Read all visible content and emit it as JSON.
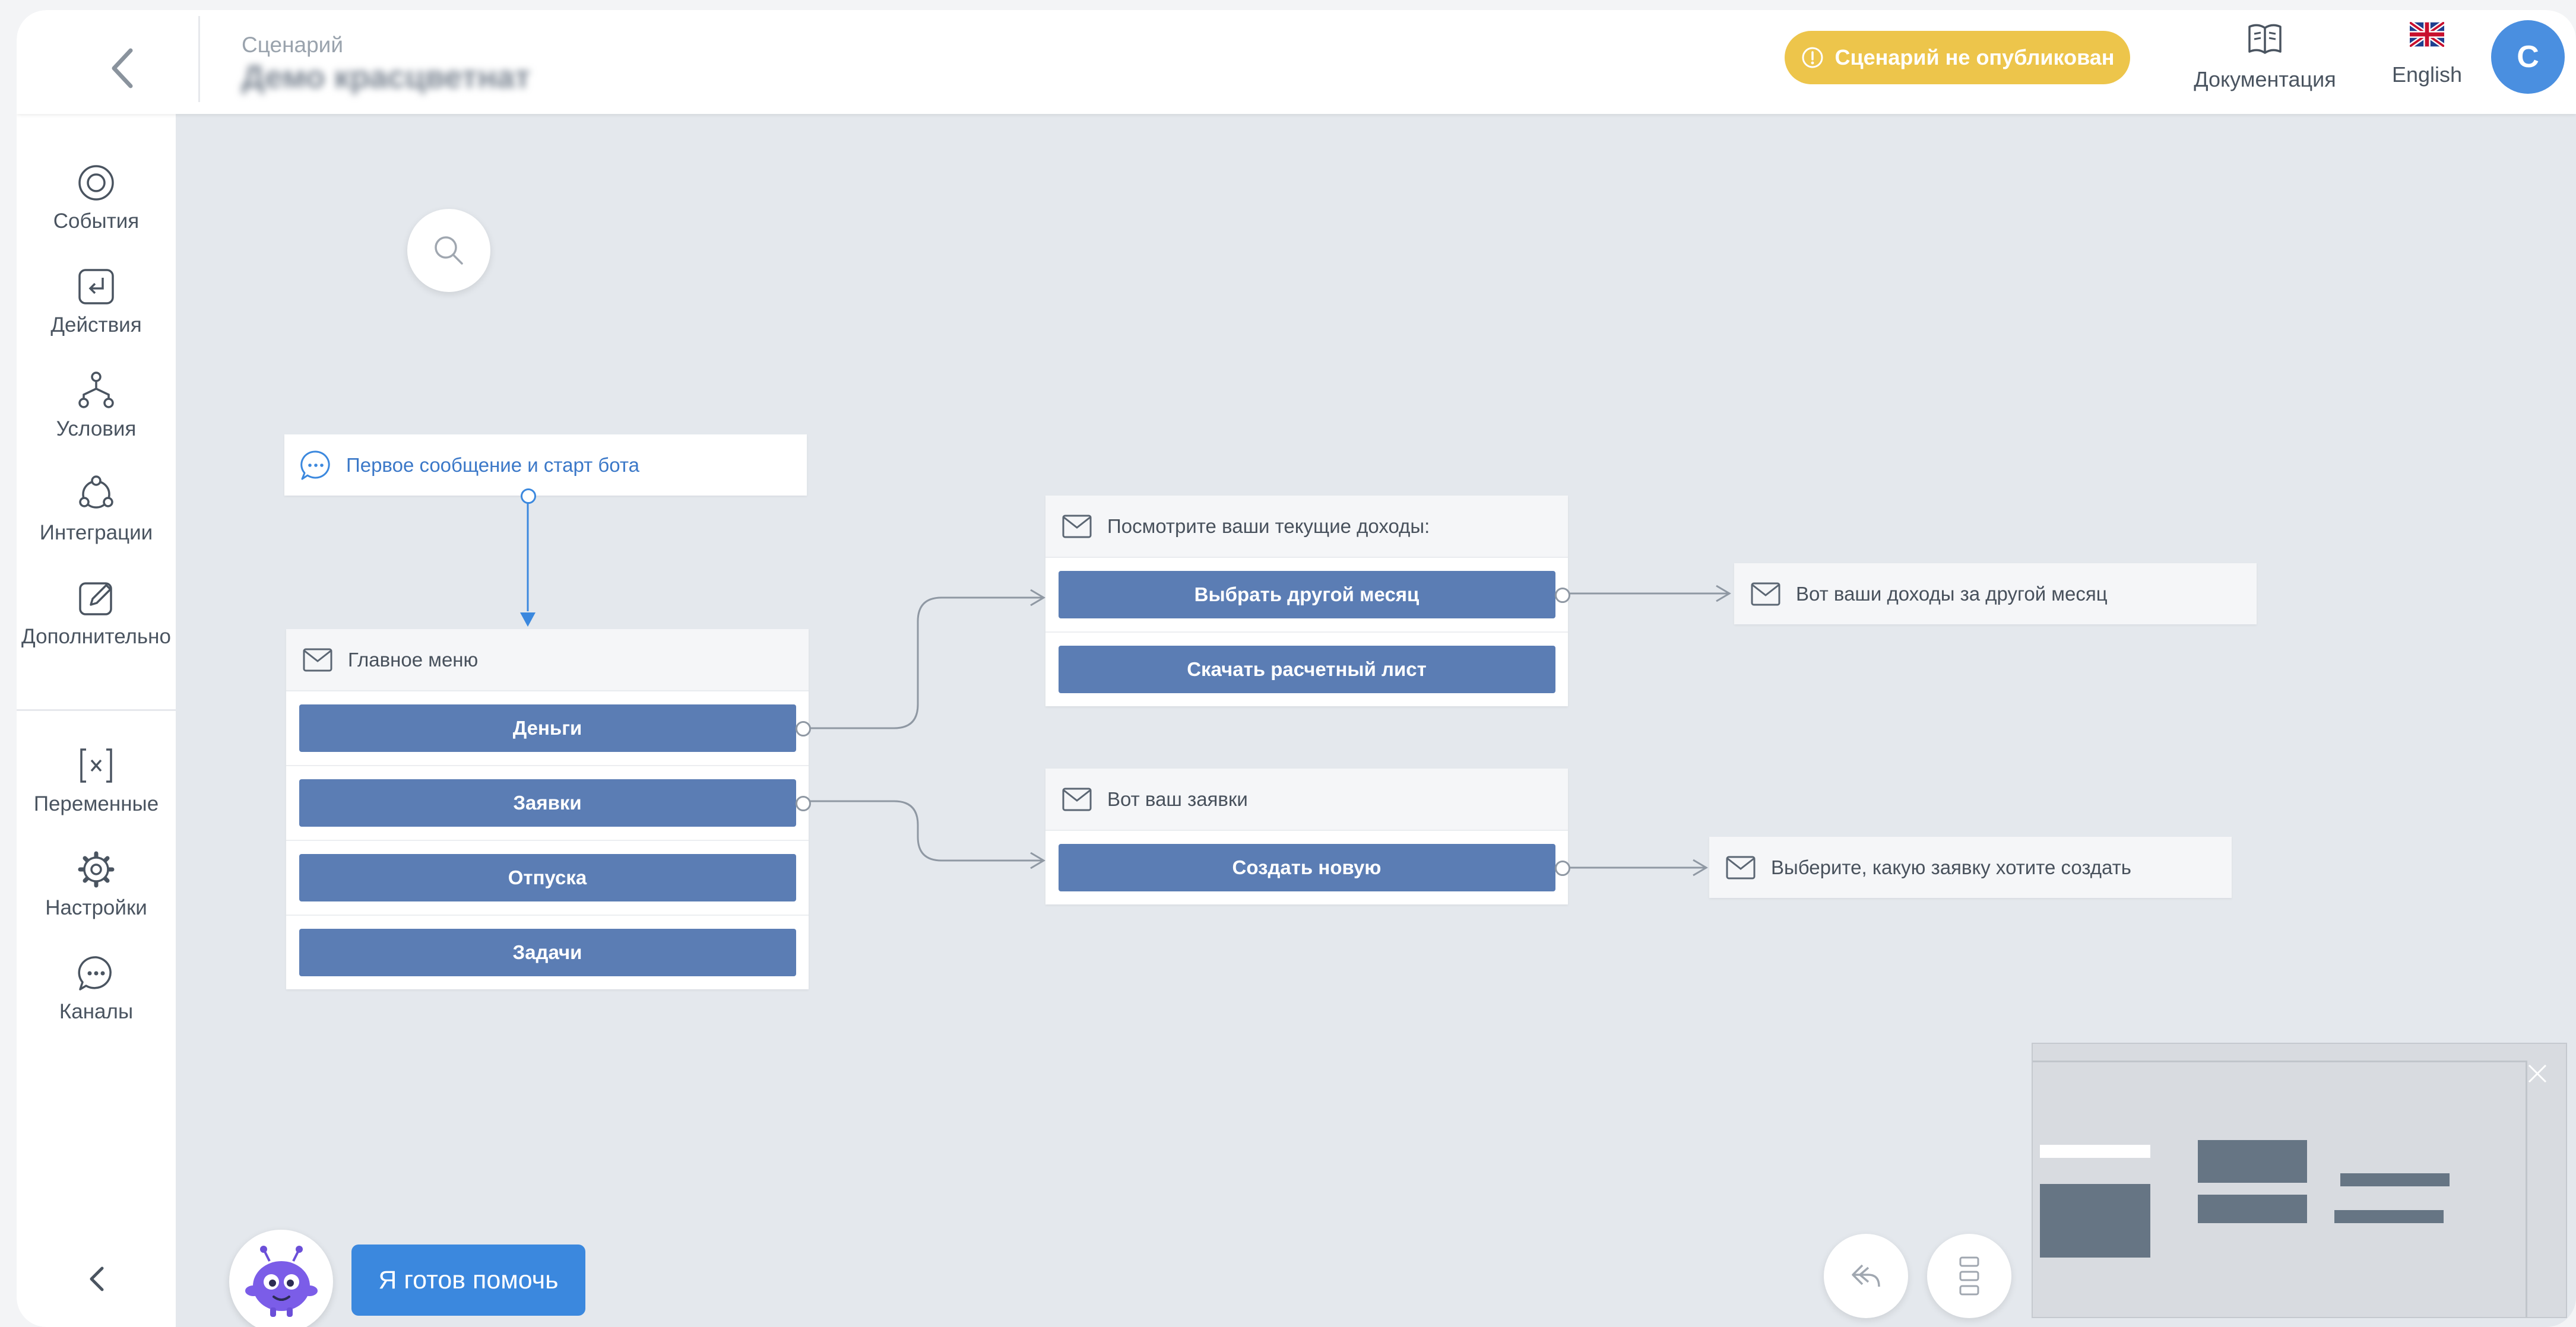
{
  "header": {
    "caption": "Сценарий",
    "scenario_name": "Демо красцветнат",
    "status": "Сценарий не опубликован",
    "docs_label": "Документация",
    "language_label": "English",
    "avatar_initial": "C"
  },
  "sidebar": {
    "items": [
      {
        "label": "События",
        "icon": "events-icon"
      },
      {
        "label": "Действия",
        "icon": "actions-icon"
      },
      {
        "label": "Условия",
        "icon": "conditions-icon"
      },
      {
        "label": "Интеграции",
        "icon": "integrations-icon"
      },
      {
        "label": "Дополнительно",
        "icon": "edit-icon"
      },
      {
        "label": "Переменные",
        "icon": "variables-icon"
      },
      {
        "label": "Настройки",
        "icon": "gear-icon"
      },
      {
        "label": "Каналы",
        "icon": "chat-icon"
      }
    ]
  },
  "canvas": {
    "start_node": {
      "label": "Первое сообщение и старт бота"
    },
    "main_menu": {
      "title": "Главное меню",
      "buttons": [
        "Деньги",
        "Заявки",
        "Отпуска",
        "Задачи"
      ]
    },
    "income_node": {
      "title": "Посмотрите ваши текущие доходы:",
      "buttons": [
        "Выбрать другой месяц",
        "Скачать расчетный лист"
      ]
    },
    "requests_node": {
      "title": "Вот ваш заявки",
      "buttons": [
        "Создать новую"
      ]
    },
    "other_month_node": {
      "title": "Вот ваши доходы за другой месяц"
    },
    "choose_request_node": {
      "title": "Выберите, какую заявку хотите создать"
    }
  },
  "bottom": {
    "help_label": "Я готов помочь"
  },
  "colors": {
    "accent_blue": "#3b88de",
    "node_button": "#5b7db4",
    "status_yellow": "#edc54b",
    "canvas_bg": "#e4e8ed"
  }
}
